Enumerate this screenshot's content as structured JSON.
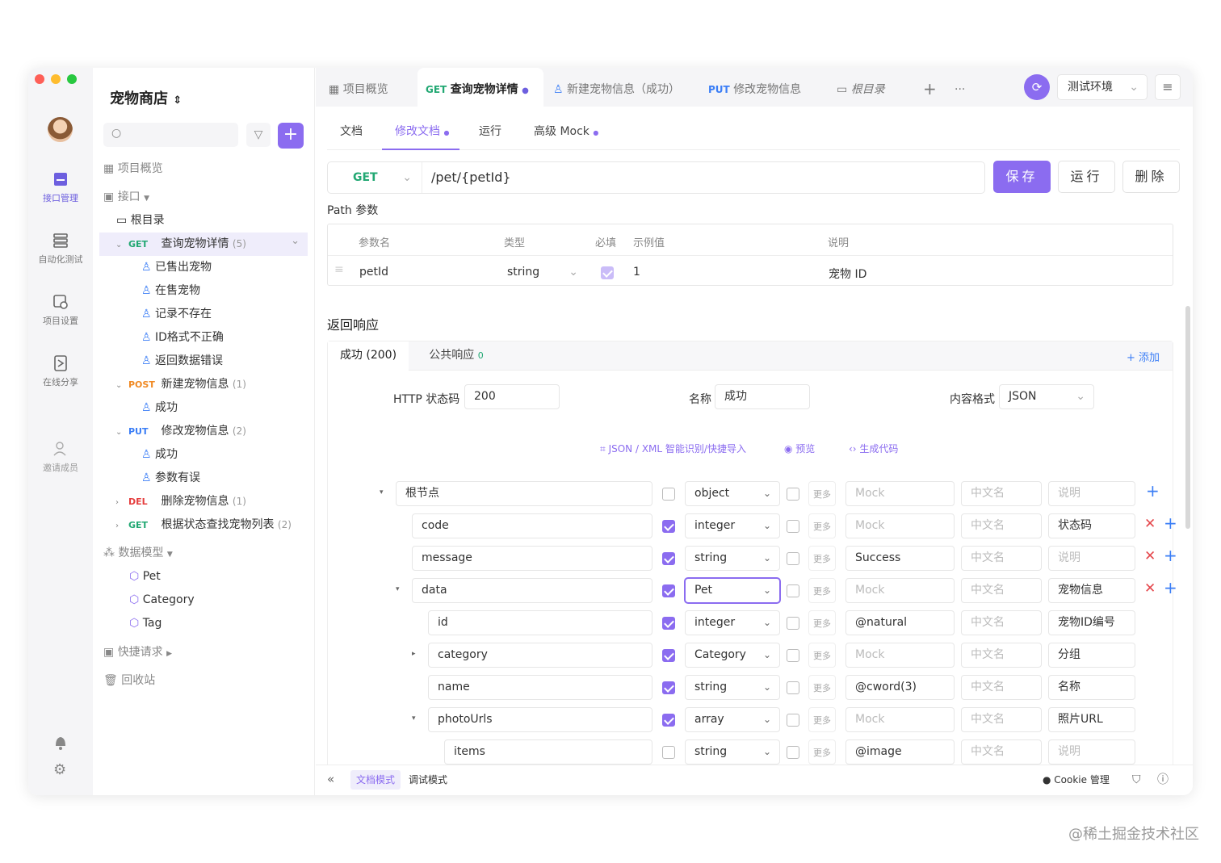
{
  "app": {
    "project_name": "宠物商店"
  },
  "rail": {
    "items": [
      {
        "label": "接口管理"
      },
      {
        "label": "自动化测试"
      },
      {
        "label": "项目设置"
      },
      {
        "label": "在线分享"
      },
      {
        "label": "邀请成员"
      }
    ]
  },
  "sidebar": {
    "overview": "项目概览",
    "api_root": "接口",
    "root_dir": "根目录",
    "endpoints": [
      {
        "method": "GET",
        "name": "查询宠物详情",
        "count": "(5)",
        "cases": [
          "已售出宠物",
          "在售宠物",
          "记录不存在",
          "ID格式不正确",
          "返回数据错误"
        ]
      },
      {
        "method": "POST",
        "name": "新建宠物信息",
        "count": "(1)",
        "cases": [
          "成功"
        ]
      },
      {
        "method": "PUT",
        "name": "修改宠物信息",
        "count": "(2)",
        "cases": [
          "成功",
          "参数有误"
        ]
      },
      {
        "method": "DEL",
        "name": "删除宠物信息",
        "count": "(1)",
        "cases": []
      },
      {
        "method": "GET",
        "name": "根据状态查找宠物列表",
        "count": "(2)",
        "cases": []
      }
    ],
    "models_label": "数据模型",
    "models": [
      "Pet",
      "Category",
      "Tag"
    ],
    "quick_request": "快捷请求",
    "trash": "回收站"
  },
  "tabs": [
    {
      "method": "",
      "label": "项目概览"
    },
    {
      "method": "GET",
      "label": "查询宠物详情"
    },
    {
      "method": "",
      "label": "新建宠物信息（成功）"
    },
    {
      "method": "PUT",
      "label": "修改宠物信息"
    },
    {
      "method": "",
      "label": "根目录"
    }
  ],
  "env": "测试环境",
  "subtabs": [
    "文档",
    "修改文档",
    "运行",
    "高级 Mock"
  ],
  "request": {
    "method": "GET",
    "path": "/pet/{petId}",
    "save": "保存",
    "run": "运行",
    "delete": "删除"
  },
  "path_params": {
    "title": "Path 参数",
    "headers": [
      "参数名",
      "类型",
      "必填",
      "示例值",
      "说明"
    ],
    "row": {
      "name": "petId",
      "type": "string",
      "example": "1",
      "desc": "宠物 ID"
    }
  },
  "response": {
    "title": "返回响应",
    "tab_success": "成功 (200)",
    "tab_common": "公共响应",
    "tab_common_count": "0",
    "add": "+ 添加",
    "status_label": "HTTP 状态码",
    "status_value": "200",
    "name_label": "名称",
    "name_value": "成功",
    "format_label": "内容格式",
    "format_value": "JSON",
    "tool_import": "JSON / XML 智能识别/快捷导入",
    "tool_preview": "预览",
    "tool_codegen": "生成代码"
  },
  "schema_rows": [
    {
      "name": "根节点",
      "required": false,
      "type": "object",
      "mock": "",
      "cn": "",
      "desc": ""
    },
    {
      "name": "code",
      "required": true,
      "type": "integer",
      "mock": "",
      "cn": "",
      "desc": "状态码"
    },
    {
      "name": "message",
      "required": true,
      "type": "string",
      "mock": "Success",
      "cn": "",
      "desc": ""
    },
    {
      "name": "data",
      "required": true,
      "type": "Pet",
      "mock": "",
      "cn": "",
      "desc": "宠物信息"
    },
    {
      "name": "id",
      "required": true,
      "type": "integer",
      "mock": "@natural",
      "cn": "",
      "desc": "宠物ID编号"
    },
    {
      "name": "category",
      "required": true,
      "type": "Category",
      "mock": "",
      "cn": "",
      "desc": "分组"
    },
    {
      "name": "name",
      "required": true,
      "type": "string",
      "mock": "@cword(3)",
      "cn": "",
      "desc": "名称"
    },
    {
      "name": "photoUrls",
      "required": true,
      "type": "array",
      "mock": "",
      "cn": "",
      "desc": "照片URL"
    },
    {
      "name": "items",
      "required": false,
      "type": "string",
      "mock": "@image",
      "cn": "",
      "desc": ""
    }
  ],
  "schema_placeholders": {
    "mock": "Mock",
    "cn": "中文名",
    "desc": "说明",
    "more": "更多"
  },
  "footer": {
    "doc_mode": "文档模式",
    "debug_mode": "调试模式",
    "cookie": "Cookie 管理"
  },
  "watermark": "@稀土掘金技术社区"
}
